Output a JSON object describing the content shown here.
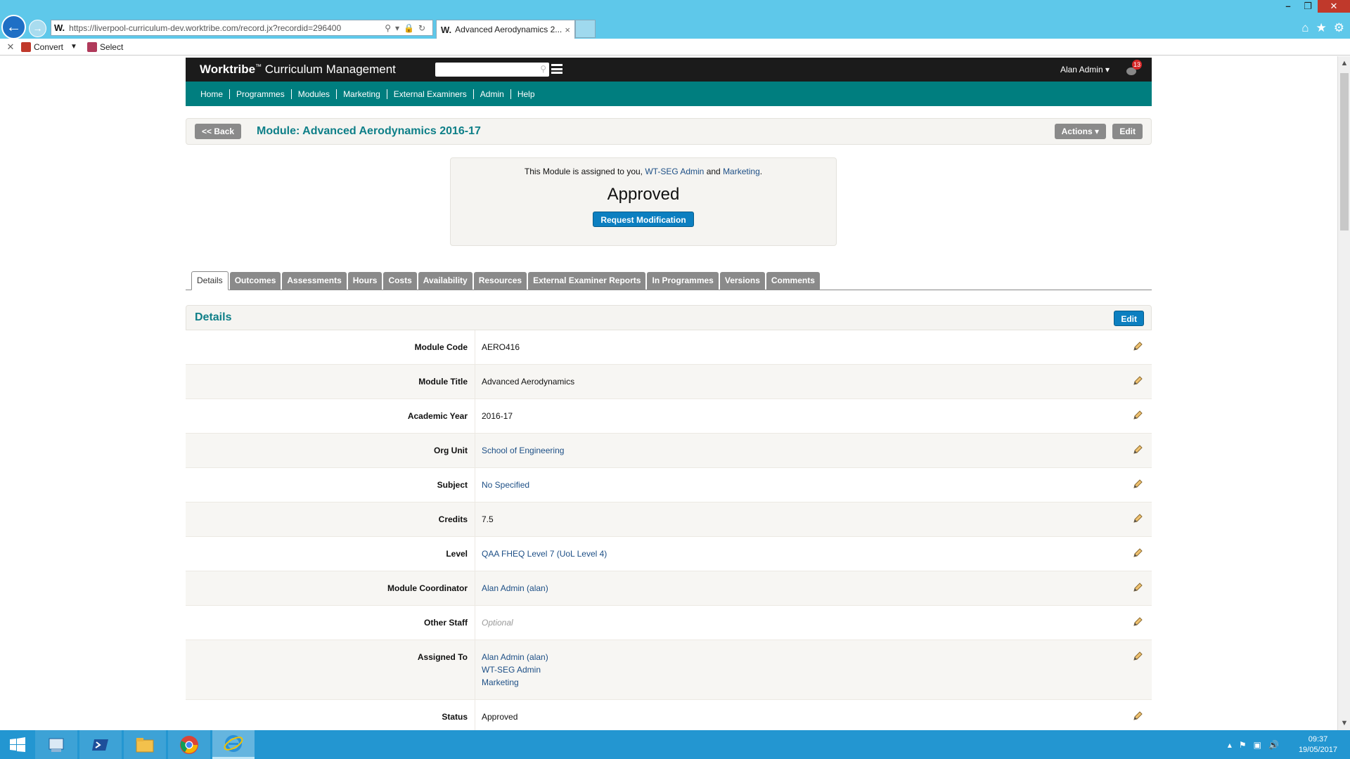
{
  "browser": {
    "address_favicon": "W.",
    "url": "https://liverpool-curriculum-dev.worktribe.com/record.jx?recordid=296400",
    "tab_favicon": "W.",
    "tab_title": "Advanced Aerodynamics 2...",
    "tab_close": "×",
    "command_bar": {
      "convert_label": "Convert",
      "select_label": "Select"
    }
  },
  "app": {
    "brand": "Worktribe",
    "brand_tm": "™",
    "product": "Curriculum Management",
    "search_placeholder": "",
    "user_menu": "Alan Admin ▾",
    "notification_count": "13",
    "nav": [
      "Home",
      "Programmes",
      "Modules",
      "Marketing",
      "External Examiners",
      "Admin",
      "Help"
    ]
  },
  "title_bar": {
    "back_label": "<< Back",
    "heading": "Module: Advanced Aerodynamics 2016-17",
    "actions_label": "Actions ▾",
    "edit_label": "Edit"
  },
  "status_panel": {
    "assigned_prefix": "This Module is assigned to you, ",
    "assigned_to_1": "WT-SEG Admin",
    "assigned_and": " and ",
    "assigned_to_2": "Marketing",
    "assigned_suffix": ".",
    "status": "Approved",
    "request_label": "Request Modification"
  },
  "tabs": [
    "Details",
    "Outcomes",
    "Assessments",
    "Hours",
    "Costs",
    "Availability",
    "Resources",
    "External Examiner Reports",
    "In Programmes",
    "Versions",
    "Comments"
  ],
  "details": {
    "title": "Details",
    "edit_label": "Edit",
    "rows": [
      {
        "label": "Module Code",
        "value": "AERO416"
      },
      {
        "label": "Module Title",
        "value": "Advanced Aerodynamics"
      },
      {
        "label": "Academic Year",
        "value": "2016-17"
      },
      {
        "label": "Org Unit",
        "value": "School of Engineering"
      },
      {
        "label": "Subject",
        "value": "No Specified"
      },
      {
        "label": "Credits",
        "value": "7.5"
      },
      {
        "label": "Level",
        "value": "QAA FHEQ Level 7 (UoL Level 4)"
      },
      {
        "label": "Module Coordinator",
        "value": "Alan Admin (alan)"
      },
      {
        "label": "Other Staff",
        "value": "Optional"
      },
      {
        "label": "Assigned To",
        "values": [
          "Alan Admin (alan)",
          "WT-SEG Admin",
          "Marketing"
        ]
      },
      {
        "label": "Status",
        "value": "Approved"
      }
    ]
  },
  "taskbar": {
    "time": "09:37",
    "date": "19/05/2017"
  },
  "colors": {
    "browser_chrome": "#5ec8ea",
    "app_header": "#1b1b1b",
    "nav_teal": "#007e7f",
    "heading_teal": "#0e7f88",
    "primary_button": "#0c7fc0",
    "link": "#1d4f86",
    "taskbar": "#2396d1"
  }
}
